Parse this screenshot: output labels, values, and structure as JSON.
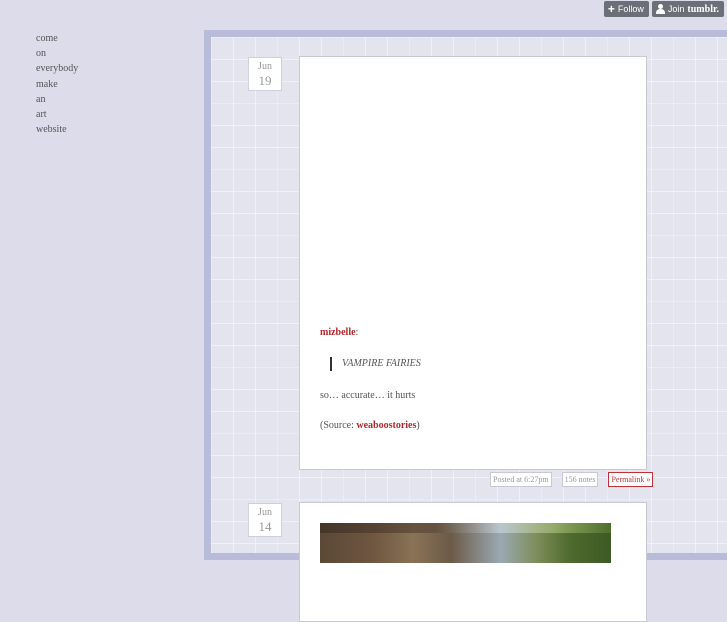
{
  "tumblr_controls": {
    "follow_label": "Follow",
    "join_label": "Join",
    "join_brand": "tumblr."
  },
  "nav": {
    "items": [
      "come",
      "on",
      "everybody",
      "make",
      "an",
      "art",
      "website"
    ]
  },
  "posts": [
    {
      "date": {
        "month": "Jun",
        "day": "19"
      },
      "author": "mizbelle",
      "author_suffix": ":",
      "quote": "VAMPIRE FAIRIES",
      "body": "so… accurate… it hurts",
      "source_prefix": "(Source: ",
      "source_link": "weaboostories",
      "source_suffix": ")",
      "meta": {
        "posted": "Posted at 6:27pm",
        "notes": "156 notes",
        "permalink": "Permalink »"
      }
    },
    {
      "date": {
        "month": "Jun",
        "day": "14"
      }
    }
  ],
  "colors": {
    "link": "#b3262c",
    "frame": "#b8bcd8",
    "background": "#dcdcea"
  }
}
